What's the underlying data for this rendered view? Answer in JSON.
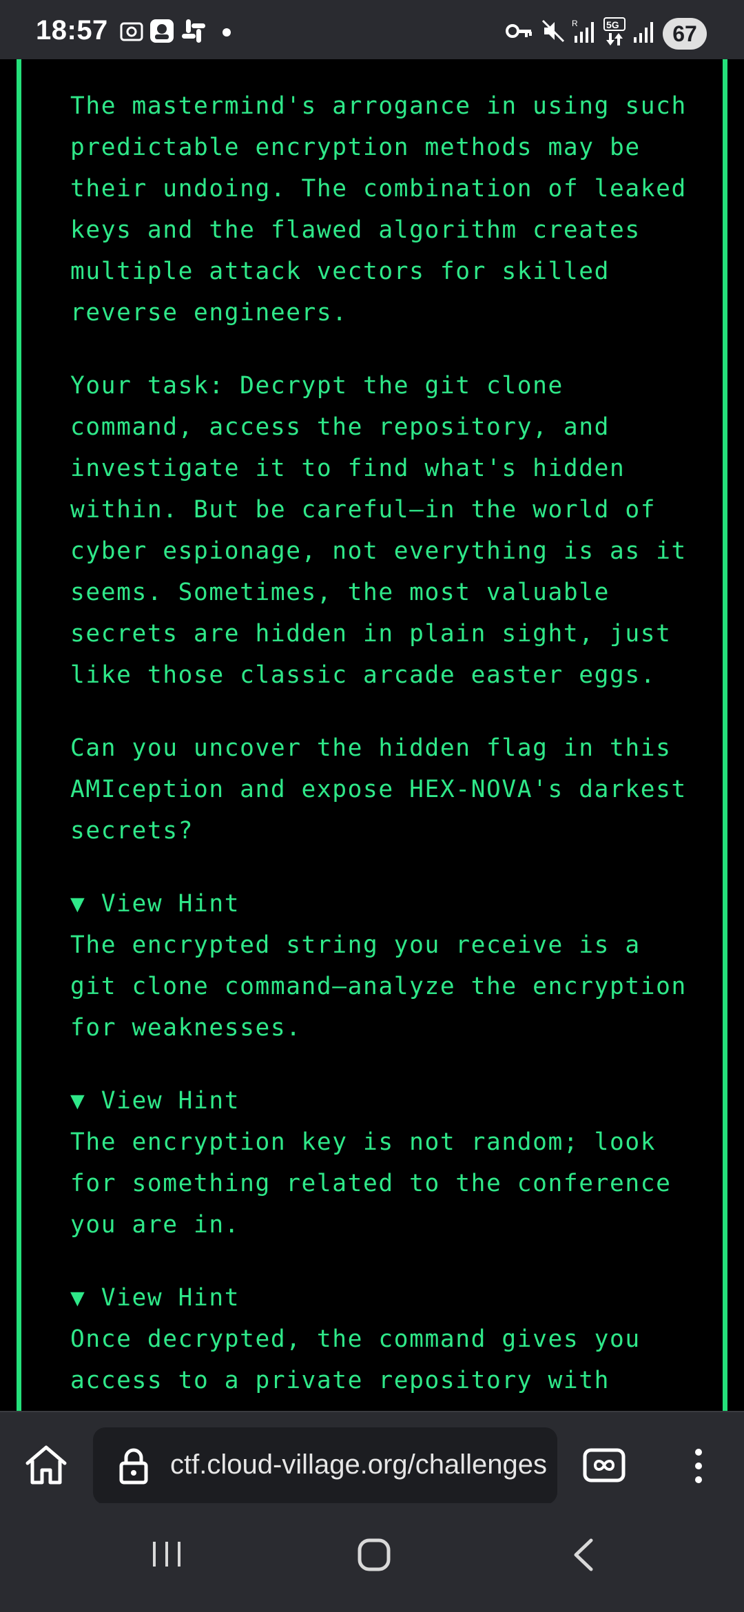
{
  "status_bar": {
    "time": "18:57",
    "battery": "67",
    "left_icons": [
      "screenshot-icon",
      "app-icon",
      "slack-icon",
      "dot-icon"
    ],
    "right_icons": [
      "vpn-key-icon",
      "mute-icon",
      "signal-icon",
      "5g-icon",
      "signal-icon"
    ]
  },
  "content": {
    "paragraphs": [
      "The mastermind's arrogance in using such\npredictable encryption methods may be\ntheir undoing. The combination of leaked\nkeys and the flawed algorithm creates\nmultiple attack vectors for skilled\nreverse engineers.",
      "Your task: Decrypt the git clone\ncommand, access the repository, and\ninvestigate it to find what's hidden\nwithin. But be careful—in the world of\ncyber espionage, not everything is as it\nseems. Sometimes, the most valuable\nsecrets are hidden in plain sight, just\nlike those classic arcade easter eggs.",
      "Can you uncover the hidden flag in this\nAMIception and expose HEX-NOVA's darkest\nsecrets?"
    ],
    "hints": [
      {
        "summary": "▼ View Hint",
        "body": "The encrypted string you receive is a\ngit clone command—analyze the encryption\nfor weaknesses."
      },
      {
        "summary": "▼ View Hint",
        "body": "The encryption key is not random; look\nfor something related to the conference\nyou are in."
      },
      {
        "summary": "▼ View Hint",
        "body": "Once decrypted, the command gives you\naccess to a private repository with"
      }
    ]
  },
  "browser": {
    "url": "ctf.cloud-village.org/challenges",
    "icons": [
      "home-icon",
      "lock-icon",
      "tab-switcher-icon",
      "more-menu-icon"
    ]
  },
  "colors": {
    "terminal_green": "#2fe889",
    "border_green": "#24e07a",
    "background": "#000000",
    "chrome": "#2a2b30"
  }
}
